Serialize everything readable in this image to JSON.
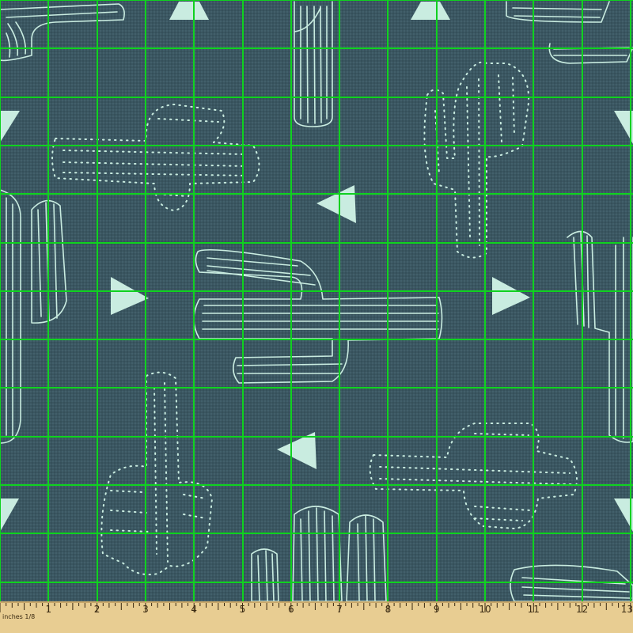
{
  "fabric": {
    "background_color": "#3b5661",
    "motif_color": "#c9ece0",
    "grid_color": "#0fd21f",
    "motifs": [
      "cactus-outline",
      "cactus-dotted",
      "triangle"
    ]
  },
  "ruler": {
    "unit_label": "inches 1/8",
    "numbers": [
      "1",
      "2",
      "3",
      "4",
      "5",
      "6",
      "7",
      "8",
      "9",
      "10",
      "11",
      "12",
      "13"
    ],
    "color": "#e8cd92"
  }
}
